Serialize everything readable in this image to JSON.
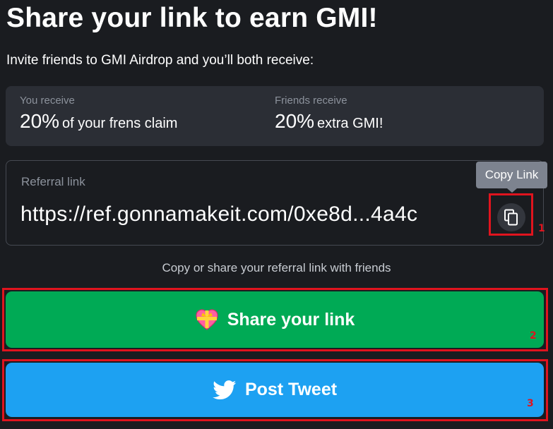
{
  "header": {
    "title": "Share your link to earn GMI!",
    "subtitle": "Invite friends to GMI Airdrop and you’ll both receive:"
  },
  "rewards": {
    "you": {
      "label": "You receive",
      "percent": "20%",
      "description": "of your frens claim"
    },
    "friends": {
      "label": "Friends receive",
      "percent": "20%",
      "description": "extra GMI!"
    }
  },
  "referral": {
    "label": "Referral link",
    "url": "https://ref.gonnamakeit.com/0xe8d...4a4c",
    "copy_tooltip": "Copy Link",
    "copy_icon": "copy-icon"
  },
  "hint": "Copy or share your referral link with friends",
  "buttons": {
    "share": {
      "label": "Share your link",
      "icon": "heart-gift-icon",
      "color": "#00aa55"
    },
    "tweet": {
      "label": "Post Tweet",
      "icon": "twitter-bird-icon",
      "color": "#1da1f2"
    }
  },
  "annotations": {
    "marker_1": "1",
    "marker_2": "2",
    "marker_3": "3",
    "color": "#e0141e"
  },
  "theme": {
    "background": "#1a1c20",
    "card": "#2b2e35",
    "muted_text": "#8c929c"
  }
}
